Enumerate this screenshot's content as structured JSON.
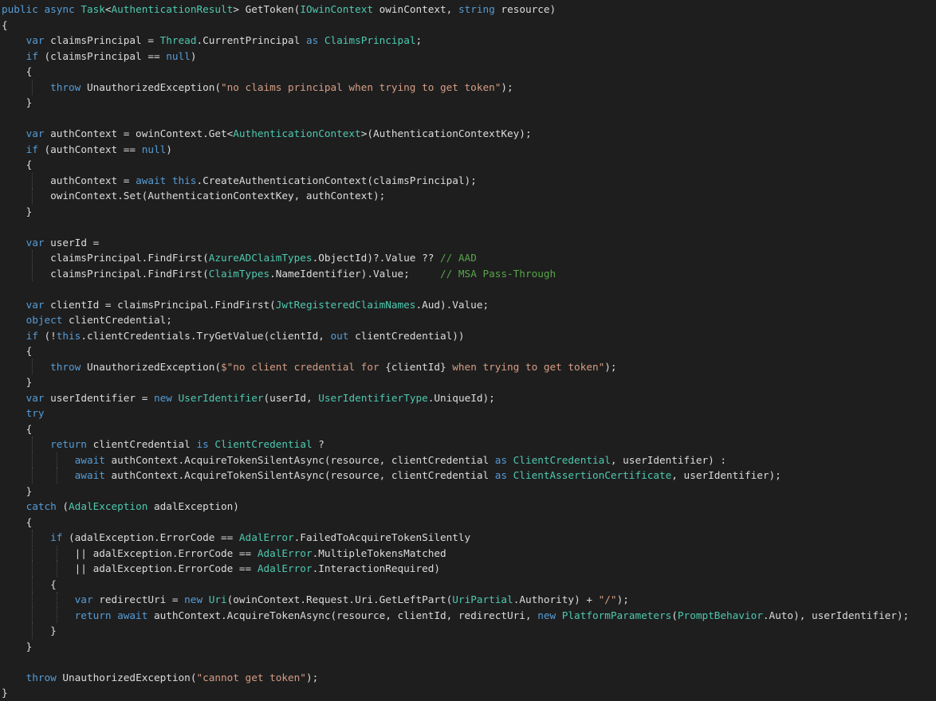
{
  "editor": {
    "theme_colors": {
      "background": "#1e1e1e",
      "keyword": "#569cd6",
      "type": "#4ec9b0",
      "string": "#d69d85",
      "comment": "#57a64a",
      "plain": "#dcdcdc"
    },
    "lines": [
      {
        "indent": 0,
        "segs": [
          [
            "k",
            "public async "
          ],
          [
            "t",
            "Task"
          ],
          [
            "p",
            "<"
          ],
          [
            "t",
            "AuthenticationResult"
          ],
          [
            "p",
            "> GetToken("
          ],
          [
            "t",
            "IOwinContext"
          ],
          [
            "p",
            " owinContext, "
          ],
          [
            "k",
            "string"
          ],
          [
            "p",
            " resource)"
          ]
        ]
      },
      {
        "indent": 0,
        "segs": [
          [
            "p",
            "{"
          ]
        ]
      },
      {
        "indent": 1,
        "segs": [
          [
            "k",
            "var"
          ],
          [
            "p",
            " claimsPrincipal = "
          ],
          [
            "t",
            "Thread"
          ],
          [
            "p",
            ".CurrentPrincipal "
          ],
          [
            "k",
            "as"
          ],
          [
            "p",
            " "
          ],
          [
            "t",
            "ClaimsPrincipal"
          ],
          [
            "p",
            ";"
          ]
        ]
      },
      {
        "indent": 1,
        "segs": [
          [
            "k",
            "if"
          ],
          [
            "p",
            " (claimsPrincipal == "
          ],
          [
            "k",
            "null"
          ],
          [
            "p",
            ")"
          ]
        ]
      },
      {
        "indent": 1,
        "segs": [
          [
            "p",
            "{"
          ]
        ]
      },
      {
        "indent": 2,
        "segs": [
          [
            "k",
            "throw"
          ],
          [
            "p",
            " UnauthorizedException("
          ],
          [
            "s",
            "\"no claims principal when trying to get token\""
          ],
          [
            "p",
            ");"
          ]
        ]
      },
      {
        "indent": 1,
        "segs": [
          [
            "p",
            "}"
          ]
        ]
      },
      {
        "indent": 0,
        "segs": []
      },
      {
        "indent": 1,
        "segs": [
          [
            "k",
            "var"
          ],
          [
            "p",
            " authContext = owinContext.Get<"
          ],
          [
            "t",
            "AuthenticationContext"
          ],
          [
            "p",
            ">(AuthenticationContextKey);"
          ]
        ]
      },
      {
        "indent": 1,
        "segs": [
          [
            "k",
            "if"
          ],
          [
            "p",
            " (authContext == "
          ],
          [
            "k",
            "null"
          ],
          [
            "p",
            ")"
          ]
        ]
      },
      {
        "indent": 1,
        "segs": [
          [
            "p",
            "{"
          ]
        ]
      },
      {
        "indent": 2,
        "segs": [
          [
            "p",
            "authContext = "
          ],
          [
            "k",
            "await this"
          ],
          [
            "p",
            ".CreateAuthenticationContext(claimsPrincipal);"
          ]
        ]
      },
      {
        "indent": 2,
        "segs": [
          [
            "p",
            "owinContext.Set(AuthenticationContextKey, authContext);"
          ]
        ]
      },
      {
        "indent": 1,
        "segs": [
          [
            "p",
            "}"
          ]
        ]
      },
      {
        "indent": 0,
        "segs": []
      },
      {
        "indent": 1,
        "segs": [
          [
            "k",
            "var"
          ],
          [
            "p",
            " userId ="
          ]
        ]
      },
      {
        "indent": 2,
        "segs": [
          [
            "p",
            "claimsPrincipal.FindFirst("
          ],
          [
            "t",
            "AzureADClaimTypes"
          ],
          [
            "p",
            ".ObjectId)?.Value ?? "
          ],
          [
            "c",
            "// AAD"
          ]
        ]
      },
      {
        "indent": 2,
        "segs": [
          [
            "p",
            "claimsPrincipal.FindFirst("
          ],
          [
            "t",
            "ClaimTypes"
          ],
          [
            "p",
            ".NameIdentifier).Value;     "
          ],
          [
            "c",
            "// MSA Pass-Through"
          ]
        ]
      },
      {
        "indent": 0,
        "segs": []
      },
      {
        "indent": 1,
        "segs": [
          [
            "k",
            "var"
          ],
          [
            "p",
            " clientId = claimsPrincipal.FindFirst("
          ],
          [
            "t",
            "JwtRegisteredClaimNames"
          ],
          [
            "p",
            ".Aud).Value;"
          ]
        ]
      },
      {
        "indent": 1,
        "segs": [
          [
            "k",
            "object"
          ],
          [
            "p",
            " clientCredential;"
          ]
        ]
      },
      {
        "indent": 1,
        "segs": [
          [
            "k",
            "if"
          ],
          [
            "p",
            " (!"
          ],
          [
            "k",
            "this"
          ],
          [
            "p",
            ".clientCredentials.TryGetValue(clientId, "
          ],
          [
            "k",
            "out"
          ],
          [
            "p",
            " clientCredential))"
          ]
        ]
      },
      {
        "indent": 1,
        "segs": [
          [
            "p",
            "{"
          ]
        ]
      },
      {
        "indent": 2,
        "segs": [
          [
            "k",
            "throw"
          ],
          [
            "p",
            " UnauthorizedException("
          ],
          [
            "s",
            "$\"no client credential for "
          ],
          [
            "p",
            "{clientId}"
          ],
          [
            "s",
            " when trying to get token\""
          ],
          [
            "p",
            ");"
          ]
        ]
      },
      {
        "indent": 1,
        "segs": [
          [
            "p",
            "}"
          ]
        ]
      },
      {
        "indent": 1,
        "segs": [
          [
            "k",
            "var"
          ],
          [
            "p",
            " userIdentifier = "
          ],
          [
            "k",
            "new"
          ],
          [
            "p",
            " "
          ],
          [
            "t",
            "UserIdentifier"
          ],
          [
            "p",
            "(userId, "
          ],
          [
            "t",
            "UserIdentifierType"
          ],
          [
            "p",
            ".UniqueId);"
          ]
        ]
      },
      {
        "indent": 1,
        "segs": [
          [
            "k",
            "try"
          ]
        ]
      },
      {
        "indent": 1,
        "segs": [
          [
            "p",
            "{"
          ]
        ]
      },
      {
        "indent": 2,
        "segs": [
          [
            "k",
            "return"
          ],
          [
            "p",
            " clientCredential "
          ],
          [
            "k",
            "is"
          ],
          [
            "p",
            " "
          ],
          [
            "t",
            "ClientCredential"
          ],
          [
            "p",
            " ?"
          ]
        ]
      },
      {
        "indent": 3,
        "segs": [
          [
            "k",
            "await"
          ],
          [
            "p",
            " authContext.AcquireTokenSilentAsync(resource, clientCredential "
          ],
          [
            "k",
            "as"
          ],
          [
            "p",
            " "
          ],
          [
            "t",
            "ClientCredential"
          ],
          [
            "p",
            ", userIdentifier) :"
          ]
        ]
      },
      {
        "indent": 3,
        "segs": [
          [
            "k",
            "await"
          ],
          [
            "p",
            " authContext.AcquireTokenSilentAsync(resource, clientCredential "
          ],
          [
            "k",
            "as"
          ],
          [
            "p",
            " "
          ],
          [
            "t",
            "ClientAssertionCertificate"
          ],
          [
            "p",
            ", userIdentifier);"
          ]
        ]
      },
      {
        "indent": 1,
        "segs": [
          [
            "p",
            "}"
          ]
        ]
      },
      {
        "indent": 1,
        "segs": [
          [
            "k",
            "catch"
          ],
          [
            "p",
            " ("
          ],
          [
            "t",
            "AdalException"
          ],
          [
            "p",
            " adalException)"
          ]
        ]
      },
      {
        "indent": 1,
        "segs": [
          [
            "p",
            "{"
          ]
        ]
      },
      {
        "indent": 2,
        "segs": [
          [
            "k",
            "if"
          ],
          [
            "p",
            " (adalException.ErrorCode == "
          ],
          [
            "t",
            "AdalError"
          ],
          [
            "p",
            ".FailedToAcquireTokenSilently"
          ]
        ]
      },
      {
        "indent": 3,
        "segs": [
          [
            "p",
            "|| adalException.ErrorCode == "
          ],
          [
            "t",
            "AdalError"
          ],
          [
            "p",
            ".MultipleTokensMatched"
          ]
        ]
      },
      {
        "indent": 3,
        "segs": [
          [
            "p",
            "|| adalException.ErrorCode == "
          ],
          [
            "t",
            "AdalError"
          ],
          [
            "p",
            ".InteractionRequired)"
          ]
        ]
      },
      {
        "indent": 2,
        "segs": [
          [
            "p",
            "{"
          ]
        ]
      },
      {
        "indent": 3,
        "segs": [
          [
            "k",
            "var"
          ],
          [
            "p",
            " redirectUri = "
          ],
          [
            "k",
            "new"
          ],
          [
            "p",
            " "
          ],
          [
            "t",
            "Uri"
          ],
          [
            "p",
            "(owinContext.Request.Uri.GetLeftPart("
          ],
          [
            "t",
            "UriPartial"
          ],
          [
            "p",
            ".Authority) + "
          ],
          [
            "s",
            "\"/\""
          ],
          [
            "p",
            ");"
          ]
        ]
      },
      {
        "indent": 3,
        "segs": [
          [
            "k",
            "return await"
          ],
          [
            "p",
            " authContext.AcquireTokenAsync(resource, clientId, redirectUri, "
          ],
          [
            "k",
            "new"
          ],
          [
            "p",
            " "
          ],
          [
            "t",
            "PlatformParameters"
          ],
          [
            "p",
            "("
          ],
          [
            "t",
            "PromptBehavior"
          ],
          [
            "p",
            ".Auto), userIdentifier);"
          ]
        ]
      },
      {
        "indent": 2,
        "segs": [
          [
            "p",
            "}"
          ]
        ]
      },
      {
        "indent": 1,
        "segs": [
          [
            "p",
            "}"
          ]
        ]
      },
      {
        "indent": 0,
        "segs": []
      },
      {
        "indent": 1,
        "segs": [
          [
            "k",
            "throw"
          ],
          [
            "p",
            " UnauthorizedException("
          ],
          [
            "s",
            "\"cannot get token\""
          ],
          [
            "p",
            ");"
          ]
        ]
      },
      {
        "indent": 0,
        "segs": [
          [
            "p",
            "}"
          ]
        ]
      }
    ]
  }
}
